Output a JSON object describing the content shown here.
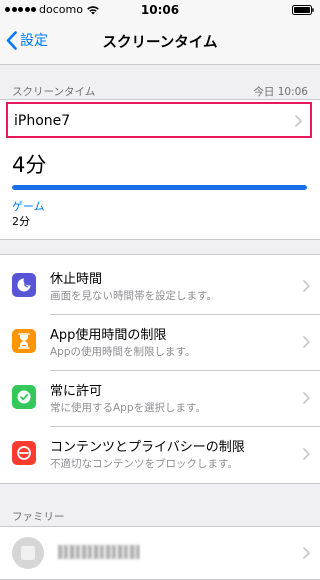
{
  "status_bar": {
    "carrier": "docomo",
    "time": "10:06"
  },
  "nav": {
    "back_label": "設定",
    "title": "スクリーンタイム"
  },
  "screen_time": {
    "section_label": "スクリーンタイム",
    "updated_label": "今日 10:06",
    "device_name": "iPhone7",
    "total_usage": "4分",
    "usage_fraction": 1.0,
    "category_label": "ゲーム",
    "category_value": "2分"
  },
  "menu": {
    "items": [
      {
        "title": "休止時間",
        "subtitle": "画面を見ない時間帯を設定します。",
        "icon": "moon-icon",
        "color": "#5856d6"
      },
      {
        "title": "App使用時間の制限",
        "subtitle": "Appの使用時間を制限します。",
        "icon": "hourglass-icon",
        "color": "#ff9500"
      },
      {
        "title": "常に許可",
        "subtitle": "常に使用するAppを選択します。",
        "icon": "checkmark-badge-icon",
        "color": "#34c759"
      },
      {
        "title": "コンテンツとプライバシーの制限",
        "subtitle": "不適切なコンテンツをブロックします。",
        "icon": "no-entry-icon",
        "color": "#ff3b30"
      }
    ]
  },
  "family": {
    "section_label": "ファミリー"
  },
  "colors": {
    "accent": "#007aff",
    "highlight_border": "#e6195a",
    "usage_bar": "#1a6fe6"
  }
}
